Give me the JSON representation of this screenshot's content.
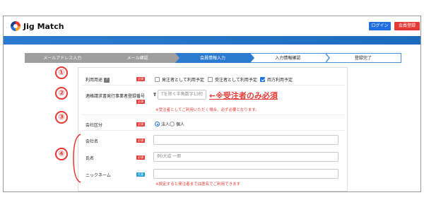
{
  "header": {
    "logo_text": "Jig Match",
    "login_label": "ログイン",
    "register_label": "会員登録"
  },
  "steps": [
    {
      "label": "メールアドレス入力",
      "state": "done"
    },
    {
      "label": "メール確認",
      "state": "done"
    },
    {
      "label": "会員情報入力",
      "state": "active"
    },
    {
      "label": "入力情報確認",
      "state": "todo"
    },
    {
      "label": "登録完了",
      "state": "todo"
    }
  ],
  "callouts": [
    "①",
    "②",
    "③",
    "④"
  ],
  "badges": {
    "required": "必須",
    "optional": "任意"
  },
  "usage": {
    "label": "利用用途",
    "help_icon": "?",
    "options": [
      {
        "label": "発注者として利用予定",
        "checked": false
      },
      {
        "label": "受注者として利用予定",
        "checked": false
      },
      {
        "label": "両方利用予定",
        "checked": true
      }
    ]
  },
  "invoice": {
    "label": "適格請求書発行事業者登録番号",
    "prefix": "T",
    "placeholder": "Tを除く半角数字13桁",
    "annotation": "←※受注者のみ必須",
    "note": "※受注者としてご利用いただく場合、必ず必要となります。"
  },
  "company_type": {
    "label": "会社区分",
    "options": [
      {
        "label": "法人",
        "selected": true
      },
      {
        "label": "個人",
        "selected": false
      }
    ]
  },
  "company_name": {
    "label": "会社名",
    "value": ""
  },
  "full_name": {
    "label": "氏名",
    "placeholder": "例)大成 一郎"
  },
  "nickname": {
    "label": "ニックネーム",
    "value": "",
    "note": "※設定すると発注者までは匿名でご利用できます"
  },
  "colors": {
    "accent": "#1f6fe0",
    "danger": "#e53935",
    "bar": "#2b7cd1"
  }
}
